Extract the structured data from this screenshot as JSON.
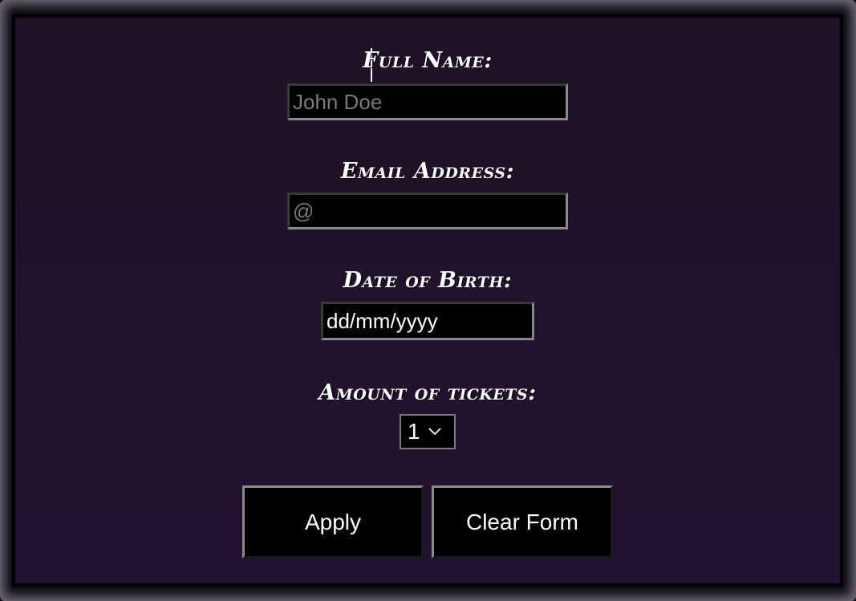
{
  "form": {
    "full_name": {
      "label": "Full Name:",
      "placeholder": "John Doe",
      "value": ""
    },
    "email": {
      "label": "Email Address:",
      "placeholder": "@",
      "value": ""
    },
    "dob": {
      "label": "Date of Birth:",
      "value": "dd/mm/yyyy"
    },
    "tickets": {
      "label": "Amount of tickets:",
      "selected": "1"
    },
    "buttons": {
      "apply": "Apply",
      "clear": "Clear Form"
    }
  },
  "icons": {
    "select_arrow": "chevron-down-icon"
  }
}
